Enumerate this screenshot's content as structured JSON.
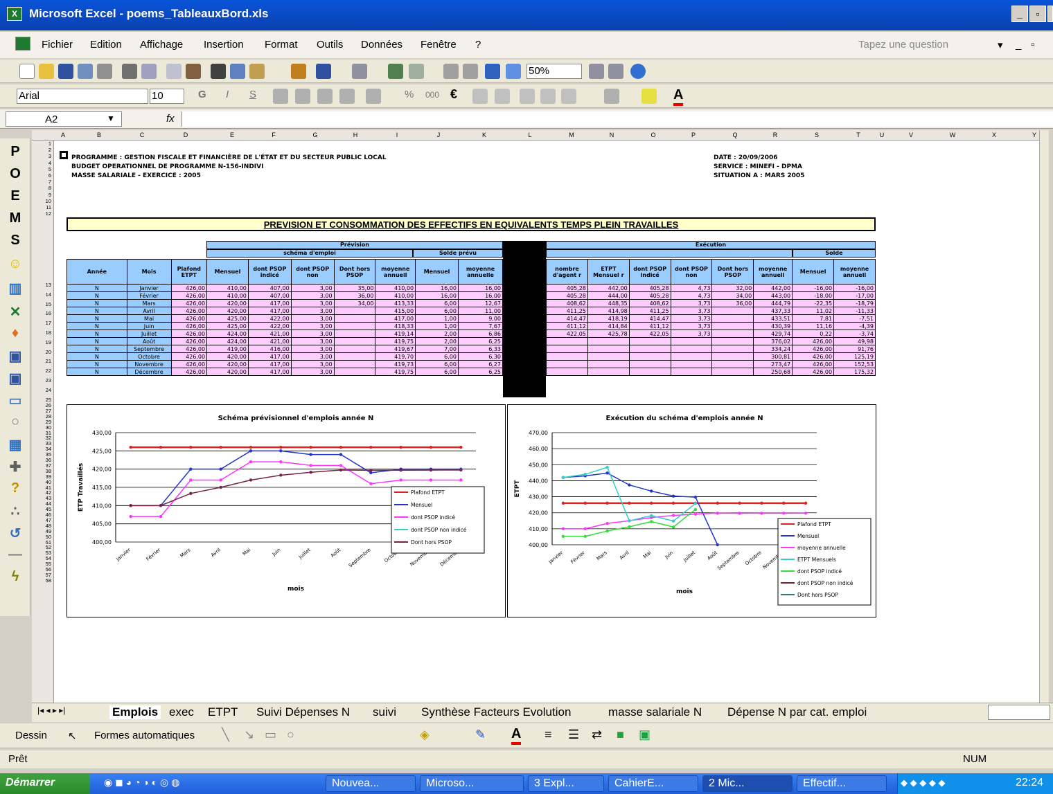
{
  "window": {
    "title": "Microsoft Excel - poems_TableauxBord.xls"
  },
  "menu": {
    "items": [
      "Fichier",
      "Edition",
      "Affichage",
      "Insertion",
      "Format",
      "Outils",
      "Données",
      "Fenêtre",
      "?"
    ],
    "help_placeholder": "Tapez une question"
  },
  "toolbar": {
    "zoom": "50%",
    "font": "Arial",
    "size": "10"
  },
  "formula": {
    "cell": "A2",
    "fx": "fx"
  },
  "left_toolbar": [
    "P",
    "O",
    "E",
    "M",
    "S"
  ],
  "sheet": {
    "columns": [
      "A",
      "B",
      "C",
      "D",
      "E",
      "F",
      "G",
      "H",
      "I",
      "J",
      "K",
      "L",
      "M",
      "N",
      "O",
      "P",
      "Q",
      "R",
      "S",
      "T",
      "U",
      "V",
      "W",
      "X",
      "Y"
    ],
    "header_left": [
      "PROGRAMME : GESTION FISCALE ET FINANCIÈRE DE L'ÉTAT ET DU SECTEUR PUBLIC LOCAL",
      "BUDGET OPERATIONNEL DE PROGRAMME N-156-INDIVI",
      "MASSE SALARIALE - EXERCICE : 2005"
    ],
    "header_right": [
      "DATE : 20/09/2006",
      "SERVICE : MINEFI - DPMA",
      "SITUATION A : MARS 2005"
    ],
    "banner": "PREVISION ET CONSOMMATION DES EFFECTIFS EN EQUIVALENTS TEMPS PLEIN TRAVAILLES",
    "group_prev": "Prévision",
    "group_exec": "Exécution",
    "sub_schema": "schéma d'emploi",
    "sub_solde_prev": "Solde prévu",
    "sub_solde": "Solde",
    "col_headers_left": [
      "Année",
      "Mois",
      "Plafond ETPT",
      "Mensuel",
      "dont PSOP indicé",
      "dont PSOP non",
      "Dont hors PSOP",
      "moyenne annuell",
      "Mensuel",
      "moyenne annuelle"
    ],
    "col_headers_right": [
      "nombre d'agent r",
      "ETPT Mensuel r",
      "dont PSOP indicé",
      "dont PSOP non",
      "Dont hors PSOP",
      "moyenne annuell",
      "Mensuel",
      "moyenne annuell"
    ],
    "rows": [
      [
        "N",
        "Janvier",
        "426,00",
        "410,00",
        "407,00",
        "3,00",
        "35,00",
        "410,00",
        "16,00",
        "16,00",
        "405,28",
        "442,00",
        "405,28",
        "4,73",
        "32,00",
        "442,00",
        "-16,00",
        "-16,00"
      ],
      [
        "N",
        "Février",
        "426,00",
        "410,00",
        "407,00",
        "3,00",
        "36,00",
        "410,00",
        "16,00",
        "16,00",
        "405,28",
        "444,00",
        "405,28",
        "4,73",
        "34,00",
        "443,00",
        "-18,00",
        "-17,00"
      ],
      [
        "N",
        "Mars",
        "426,00",
        "420,00",
        "417,00",
        "3,00",
        "34,00",
        "413,33",
        "6,00",
        "12,67",
        "408,62",
        "448,35",
        "408,62",
        "3,73",
        "36,00",
        "444,79",
        "-22,35",
        "-18,79"
      ],
      [
        "N",
        "Avril",
        "426,00",
        "420,00",
        "417,00",
        "3,00",
        "",
        "415,00",
        "6,00",
        "11,00",
        "411,25",
        "414,98",
        "411,25",
        "3,73",
        "",
        "437,33",
        "11,02",
        "-11,33"
      ],
      [
        "N",
        "Mai",
        "426,00",
        "425,00",
        "422,00",
        "3,00",
        "",
        "417,00",
        "1,00",
        "9,00",
        "414,47",
        "418,19",
        "414,47",
        "3,73",
        "",
        "433,51",
        "7,81",
        "-7,51"
      ],
      [
        "N",
        "Juin",
        "426,00",
        "425,00",
        "422,00",
        "3,00",
        "",
        "418,33",
        "1,00",
        "7,67",
        "411,12",
        "414,84",
        "411,12",
        "3,73",
        "",
        "430,39",
        "11,16",
        "-4,39"
      ],
      [
        "N",
        "Juillet",
        "426,00",
        "424,00",
        "421,00",
        "3,00",
        "",
        "419,14",
        "2,00",
        "6,86",
        "422,05",
        "425,78",
        "422,05",
        "3,73",
        "",
        "429,74",
        "0,22",
        "-3,74"
      ],
      [
        "N",
        "Août",
        "426,00",
        "424,00",
        "421,00",
        "3,00",
        "",
        "419,75",
        "2,00",
        "6,25",
        "",
        "",
        "",
        "",
        "",
        "376,02",
        "426,00",
        "49,98"
      ],
      [
        "N",
        "Septembre",
        "426,00",
        "419,00",
        "416,00",
        "3,00",
        "",
        "419,67",
        "7,00",
        "6,33",
        "",
        "",
        "",
        "",
        "",
        "334,24",
        "426,00",
        "91,76"
      ],
      [
        "N",
        "Octobre",
        "426,00",
        "420,00",
        "417,00",
        "3,00",
        "",
        "419,70",
        "6,00",
        "6,30",
        "",
        "",
        "",
        "",
        "",
        "300,81",
        "426,00",
        "125,19"
      ],
      [
        "N",
        "Novembre",
        "426,00",
        "420,00",
        "417,00",
        "3,00",
        "",
        "419,73",
        "6,00",
        "6,27",
        "",
        "",
        "",
        "",
        "",
        "273,47",
        "426,00",
        "152,53"
      ],
      [
        "N",
        "Décembre",
        "426,00",
        "420,00",
        "417,00",
        "3,00",
        "",
        "419,75",
        "6,00",
        "6,25",
        "",
        "",
        "",
        "",
        "",
        "250,68",
        "426,00",
        "175,32"
      ]
    ]
  },
  "chart_data": [
    {
      "type": "line",
      "title": "Schéma prévisionnel d'emplois année N",
      "xlabel": "mois",
      "ylabel": "ETP Travaillés",
      "ylim": [
        400,
        430
      ],
      "yticks": [
        "430,00",
        "425,00",
        "420,00",
        "415,00",
        "410,00",
        "405,00",
        "400,00"
      ],
      "categories": [
        "Janvier",
        "Février",
        "Mars",
        "Avril",
        "Mai",
        "Juin",
        "Juillet",
        "Août",
        "Septembre",
        "Octobre",
        "Novembre",
        "Décembre"
      ],
      "series": [
        {
          "name": "Plafond ETPT",
          "color": "#dd2222",
          "values": [
            426,
            426,
            426,
            426,
            426,
            426,
            426,
            426,
            426,
            426,
            426,
            426
          ]
        },
        {
          "name": "Mensuel",
          "color": "#2233cc",
          "values": [
            410,
            410,
            420,
            420,
            425,
            425,
            424,
            424,
            419,
            420,
            420,
            420
          ]
        },
        {
          "name": "dont PSOP indicé",
          "color": "#ff33ff",
          "values": [
            407,
            407,
            417,
            417,
            422,
            422,
            421,
            421,
            416,
            417,
            417,
            417
          ]
        },
        {
          "name": "dont PSOP non indicé",
          "color": "#33cccc",
          "values": [
            null,
            null,
            null,
            null,
            null,
            null,
            null,
            null,
            null,
            null,
            null,
            null
          ]
        },
        {
          "name": "Dont hors PSOP",
          "color": "#772244",
          "values": [
            410,
            410,
            413.33,
            415,
            417,
            418.33,
            419.14,
            419.75,
            419.67,
            419.7,
            419.73,
            419.75
          ]
        }
      ]
    },
    {
      "type": "line",
      "title": "Exécution du schéma d'emplois année N",
      "xlabel": "mois",
      "ylabel": "ETPT",
      "ylim": [
        400,
        470
      ],
      "yticks": [
        "470,00",
        "460,00",
        "450,00",
        "440,00",
        "430,00",
        "420,00",
        "410,00",
        "400,00"
      ],
      "categories": [
        "Janvier",
        "Février",
        "Mars",
        "Avril",
        "Mai",
        "Juin",
        "Juillet",
        "Août",
        "Septembre",
        "Octobre",
        "Novembre",
        "Décembre"
      ],
      "series": [
        {
          "name": "Plafond ETPT",
          "color": "#dd2222",
          "values": [
            426,
            426,
            426,
            426,
            426,
            426,
            426,
            426,
            426,
            426,
            426,
            426
          ]
        },
        {
          "name": "Mensuel",
          "color": "#2233cc",
          "values": [
            442,
            443,
            444.79,
            437.33,
            433.51,
            430.39,
            429.74,
            376.02,
            null,
            null,
            null,
            null
          ]
        },
        {
          "name": "moyenne annuelle",
          "color": "#ff33ff",
          "values": [
            410,
            410,
            413.33,
            415,
            417,
            418.33,
            419.14,
            419.75,
            419.67,
            419.7,
            419.73,
            419.75
          ]
        },
        {
          "name": "ETPT Mensuels",
          "color": "#33cccc",
          "values": [
            442,
            444,
            448.35,
            414.98,
            418.19,
            414.84,
            425.78,
            null,
            null,
            null,
            null,
            null
          ]
        },
        {
          "name": "dont PSOP indicé",
          "color": "#33dd33",
          "values": [
            405.28,
            405.28,
            408.62,
            411.25,
            414.47,
            411.12,
            422.05,
            null,
            null,
            null,
            null,
            null
          ]
        },
        {
          "name": "dont PSOP non indicé",
          "color": "#772222",
          "values": [
            null,
            null,
            null,
            null,
            null,
            null,
            null,
            null,
            null,
            null,
            null,
            null
          ]
        },
        {
          "name": "Dont hors PSOP",
          "color": "#337777",
          "values": [
            null,
            null,
            null,
            null,
            null,
            null,
            null,
            null,
            null,
            null,
            null,
            null
          ]
        }
      ]
    }
  ],
  "tabs": [
    "Emplois",
    "exec",
    "ETPT",
    "Suivi Dépenses N",
    "suivi",
    "Synthèse Facteurs Evolution",
    "masse salariale N",
    "Dépense N par cat. emploi"
  ],
  "drawbar": {
    "draw": "Dessin",
    "shapes": "Formes automatiques"
  },
  "status": {
    "left": "Prêt",
    "right": "NUM"
  },
  "taskbar": {
    "start": "Démarrer",
    "tasks": [
      "Nouvea...",
      "Microso...",
      "3 Expl...",
      "CahierE...",
      "2 Mic...",
      "Effectif..."
    ],
    "clock": "22:24"
  }
}
